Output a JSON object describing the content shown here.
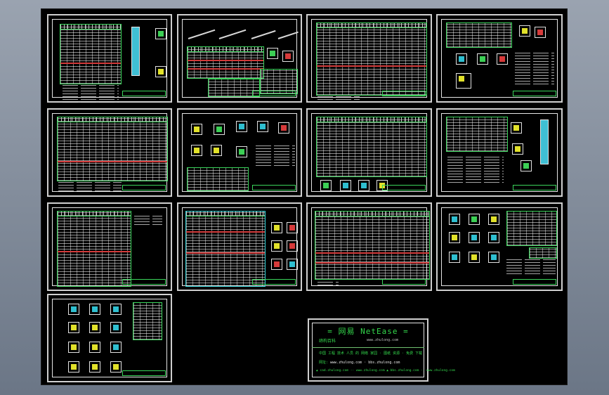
{
  "viewport": {
    "background": "#000000",
    "frame_color": "#cfcfcf"
  },
  "sheet_names": [
    "sheet-1-table-with-column-detail",
    "sheet-2-stair-details",
    "sheet-3-schedule-table",
    "sheet-4-pile-details",
    "sheet-5-schedule-table",
    "sheet-6-foundation-details",
    "sheet-7-schedule-with-details",
    "sheet-8-column-section",
    "sheet-9-schedule-table",
    "sheet-10-schedule-with-details",
    "sheet-11-schedule-table",
    "sheet-12-joint-details",
    "sheet-13-joint-details"
  ],
  "banner": {
    "title": "= 网易 NetEase =",
    "sub1": "缔构百科",
    "url1": "www.zhulong.com",
    "line1": "中国 工程 技术 人员 的 网络 家园 · 图纸 资源 · 免费 下载",
    "line2_label": "网址:",
    "line2_value": "www.zhulong.com  ·  bbs.zhulong.com",
    "line3": "▲ cad.zhulong.com ·· www.zhulong.com  ▲ bbs.zhulong.com ·· www.zhulong.com"
  },
  "colors": {
    "grid_green": "#39d45a",
    "grid_cyan": "#2fd1d6",
    "accent_red": "#d23a3a",
    "accent_yellow": "#e1e12a",
    "banner_text": "#34d84c"
  }
}
